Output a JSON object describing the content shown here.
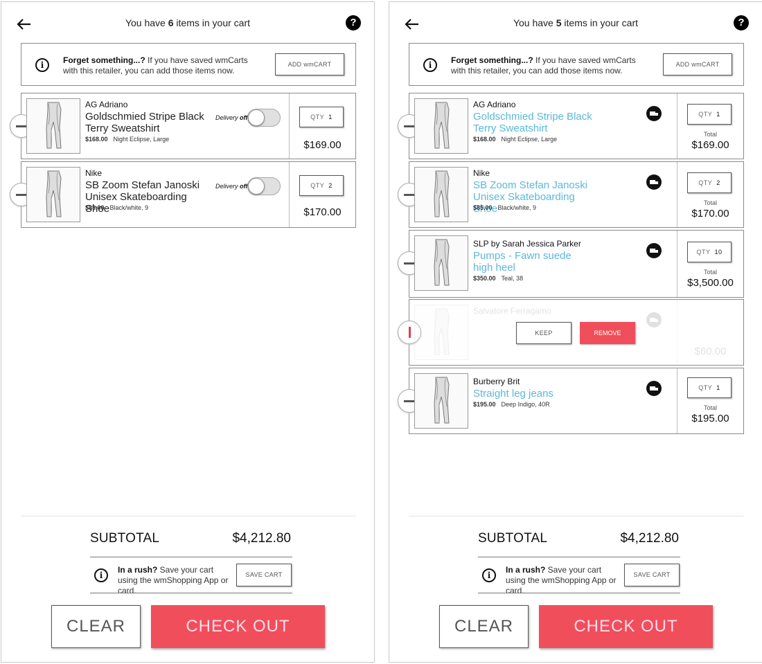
{
  "colors": {
    "accent": "#f04e5a",
    "link": "#5ab8d9"
  },
  "left": {
    "title_pre": "You have ",
    "title_count": "6",
    "title_post": " items in your cart",
    "forget_bold": "Forget something...?",
    "forget_text": " If you have saved wmCarts with this retailer, you can add those items now.",
    "add_button": "ADD wmCART",
    "items": [
      {
        "brand": "AG Adriano",
        "name": "Goldschmied Stripe Black Terry Sweatshirt",
        "price": "$168.00",
        "variant": "Night Eclipse, Large",
        "delivery_label": "Delivery",
        "delivery_state": "off",
        "qty_label": "QTY",
        "qty": "1",
        "total": "$169.00"
      },
      {
        "brand": "Nike",
        "name": "SB Zoom Stefan Janoski Unisex Skateboarding Shoe",
        "price": "$85.00",
        "variant": "Black/white, 9",
        "delivery_label": "Delivery",
        "delivery_state": "off",
        "qty_label": "QTY",
        "qty": "2",
        "total": "$170.00"
      }
    ],
    "subtotal_label": "SUBTOTAL",
    "subtotal_value": "$4,212.80",
    "rush_bold": "In a rush?",
    "rush_text": " Save your cart using the wmShopping App or card.",
    "save_button": "SAVE CART",
    "clear_button": "CLEAR",
    "checkout_button": "CHECK OUT"
  },
  "right": {
    "title_pre": "You have ",
    "title_count": "5",
    "title_post": " items in your cart",
    "forget_bold": "Forget something...?",
    "forget_text": " If you have saved wmCarts with this retailer, you can add those items now.",
    "add_button": "ADD wmCART",
    "items": [
      {
        "brand": "AG Adriano",
        "name": "Goldschmied Stripe Black Terry Sweatshirt",
        "price": "$168.00",
        "variant": "Night Eclipse, Large",
        "qty_label": "QTY",
        "qty": "1",
        "total_label": "Total",
        "total": "$169.00"
      },
      {
        "brand": "Nike",
        "name": "SB Zoom Stefan Janoski Unisex Skateboarding Shoe",
        "price": "$85.00",
        "variant": "Black/white, 9",
        "qty_label": "QTY",
        "qty": "2",
        "total_label": "Total",
        "total": "$170.00"
      },
      {
        "brand": "SLP by Sarah Jessica Parker",
        "name": "Pumps - Fawn suede high heel",
        "price": "$350.00",
        "variant": "Teal, 38",
        "qty_label": "QTY",
        "qty": "10",
        "total_label": "Total",
        "total": "$3,500.00"
      },
      {
        "brand": "Salvatore Ferragamo",
        "total": "$60.00",
        "keep_button": "KEEP",
        "remove_button": "REMOVE"
      },
      {
        "brand": "Burberry Brit",
        "name": "Straight leg jeans",
        "price": "$195.00",
        "variant": "Deep Indigo, 40R",
        "qty_label": "QTY",
        "qty": "1",
        "total_label": "Total",
        "total": "$195.00"
      }
    ],
    "subtotal_label": "SUBTOTAL",
    "subtotal_value": "$4,212.80",
    "rush_bold": "In a rush?",
    "rush_text": " Save your cart using the wmShopping App or card.",
    "save_button": "SAVE CART",
    "clear_button": "CLEAR",
    "checkout_button": "CHECK OUT"
  }
}
